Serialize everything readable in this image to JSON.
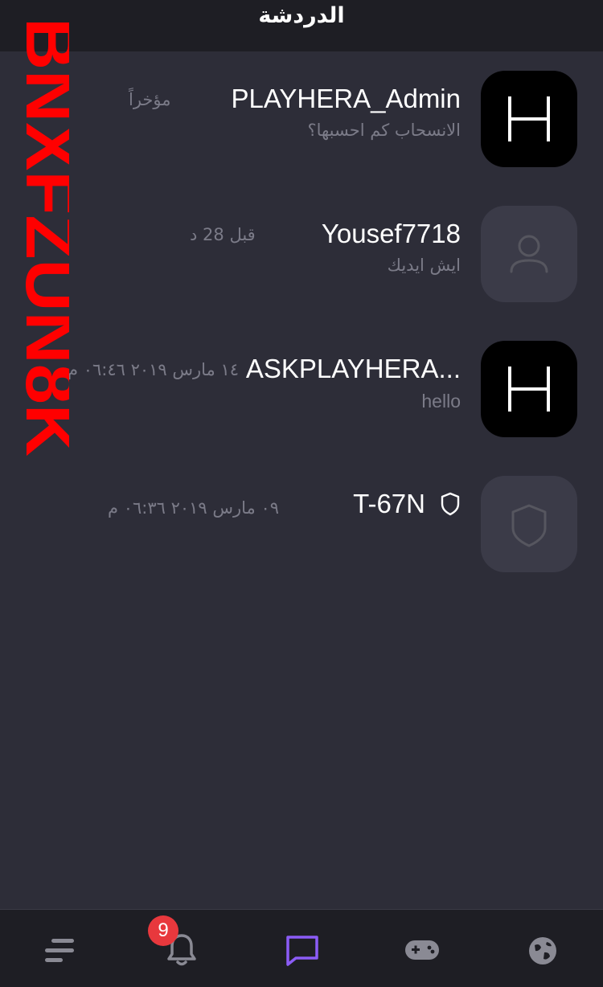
{
  "header": {
    "title": "الدردشة"
  },
  "chats": [
    {
      "name": "PLAYHERA_Admin",
      "preview": "الانسحاب كم احسبها؟",
      "time": "مؤخراً",
      "avatar": "playhera-h-logo"
    },
    {
      "name": "Yousef7718",
      "preview": "ايش ايديك",
      "time": "قبل 28 د",
      "avatar": "user-placeholder-icon"
    },
    {
      "name": "ASKPLAYHERA...",
      "preview": "hello",
      "time": "١٤ مارس ٢٠١٩ ٠٦:٤٦ م",
      "avatar": "playhera-h-logo"
    },
    {
      "name": "T-67N",
      "preview": "",
      "time": "٠٩ مارس ٢٠١٩ ٠٦:٣٦ م",
      "avatar": "shield-placeholder-icon",
      "badge_icon": "shield-icon"
    }
  ],
  "watermark": {
    "text": "BNXFZUN8K",
    "color": "#ff0000"
  },
  "bottom_nav": {
    "items": [
      {
        "icon": "menu-icon",
        "active": false
      },
      {
        "icon": "bell-icon",
        "active": false,
        "badge": "9"
      },
      {
        "icon": "chat-icon",
        "active": true
      },
      {
        "icon": "gamepad-icon",
        "active": false
      },
      {
        "icon": "globe-icon",
        "active": false
      }
    ],
    "active_color": "#8b5cf6",
    "inactive_color": "#8a8a94",
    "badge_color": "#e8383d"
  }
}
